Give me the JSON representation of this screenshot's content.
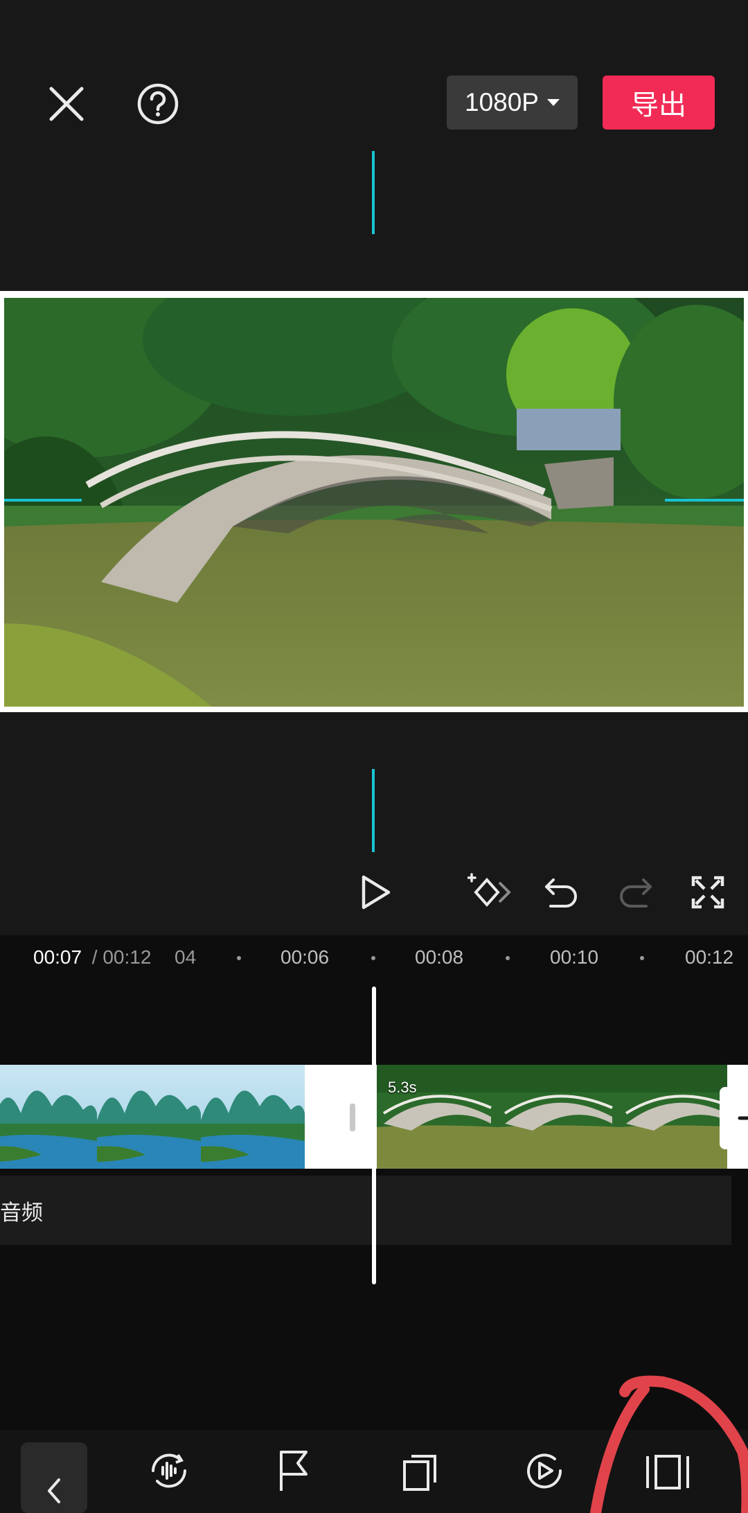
{
  "header": {
    "resolution": "1080P",
    "export_label": "导出"
  },
  "icons": {
    "close": "close-icon",
    "help": "help-icon",
    "play": "play-icon",
    "keyframe": "keyframe-icon",
    "undo": "undo-icon",
    "redo": "redo-icon",
    "fullscreen": "fullscreen-icon"
  },
  "timeline": {
    "current_time": "00:07",
    "total_time": " / 00:12",
    "ticks": [
      "04",
      "00:06",
      "00:08",
      "00:10",
      "00:12"
    ],
    "clip_duration": "5.3s",
    "audio_label": "音频"
  },
  "colors": {
    "accent_cyan": "#19c3d2",
    "export_red": "#f12b55",
    "annotation_red": "#e0444a"
  }
}
